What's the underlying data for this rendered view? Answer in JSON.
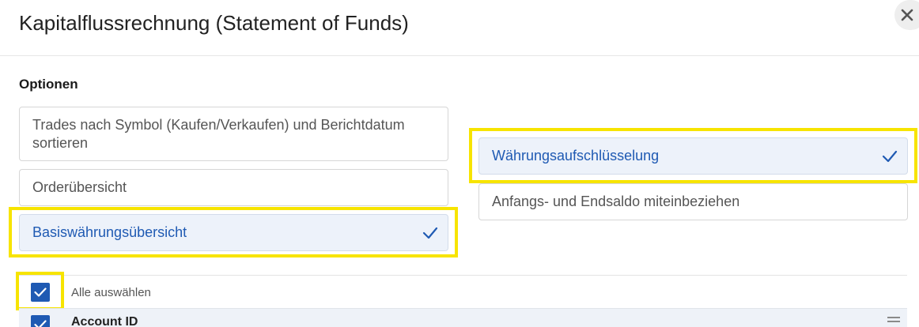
{
  "dialog": {
    "title": "Kapitalflussrechnung (Statement of Funds)",
    "close_icon": "close-icon"
  },
  "options": {
    "heading": "Optionen",
    "left": [
      {
        "label": "Trades nach Symbol (Kaufen/Verkaufen) und Berichtdatum sortieren",
        "selected": false
      },
      {
        "label": "Orderübersicht",
        "selected": false
      },
      {
        "label": "Basiswährungsübersicht",
        "selected": true
      }
    ],
    "right": [
      {
        "label": "Währungsaufschlüsselung",
        "selected": true
      },
      {
        "label": "Anfangs- und Endsaldo miteinbeziehen",
        "selected": false
      }
    ]
  },
  "fields": {
    "select_all_label": "Alle auswählen",
    "select_all_checked": true,
    "rows": [
      {
        "label": "Account ID",
        "checked": true
      }
    ]
  },
  "colors": {
    "accent": "#1f5ab3",
    "highlight": "#f7e400",
    "selected_bg": "#edf2fa"
  }
}
